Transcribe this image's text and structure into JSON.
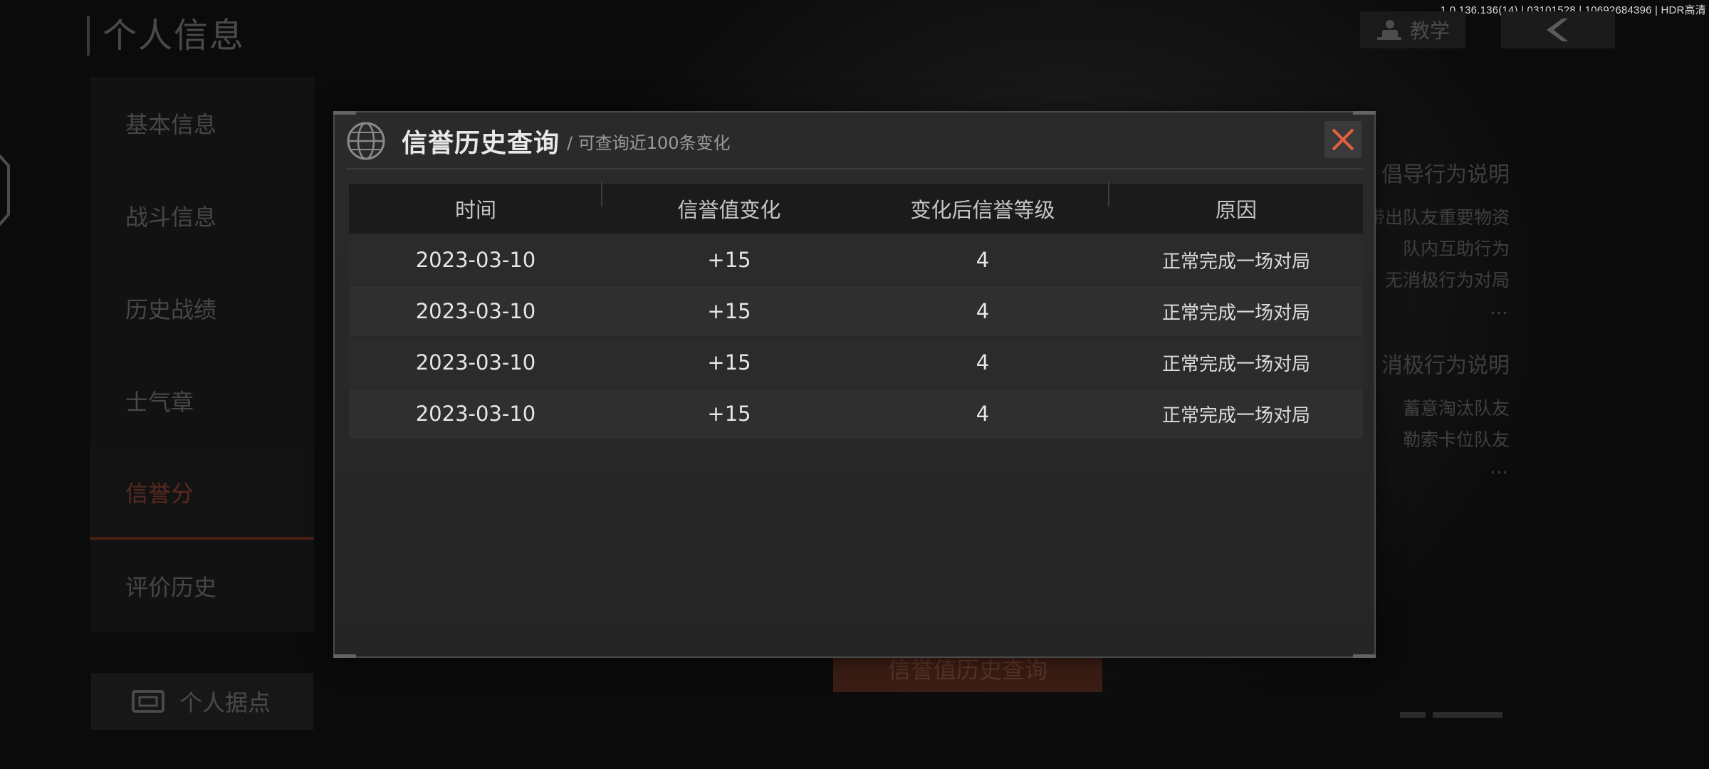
{
  "build_info": "1.0.136.136(14) | 03101528 | 10692684396 | HDR高清",
  "header": {
    "title": "个人信息",
    "tutorial_label": "教学"
  },
  "sidebar": {
    "items": [
      {
        "label": "基本信息"
      },
      {
        "label": "战斗信息"
      },
      {
        "label": "历史战绩"
      },
      {
        "label": "士气章"
      },
      {
        "label": "信誉分"
      },
      {
        "label": "评价历史"
      }
    ],
    "active_index": 4,
    "stronghold_label": "个人据点"
  },
  "right_panel": {
    "positive_title": "倡导行为说明",
    "positive_lines": [
      "带出队友重要物资",
      "队内互助行为",
      "无消极行为对局"
    ],
    "negative_title": "消极行为说明",
    "negative_lines": [
      "蓄意淘汰队友",
      "勒索卡位队友"
    ],
    "ellipsis": "…"
  },
  "bottom_button_label": "信誉值历史查询",
  "modal": {
    "title": "信誉历史查询",
    "subtitle": "/ 可查询近100条变化",
    "columns": [
      "时间",
      "信誉值变化",
      "变化后信誉等级",
      "原因"
    ],
    "rows": [
      {
        "date": "2023-03-10",
        "change": "+15",
        "level": "4",
        "reason": "正常完成一场对局"
      },
      {
        "date": "2023-03-10",
        "change": "+15",
        "level": "4",
        "reason": "正常完成一场对局"
      },
      {
        "date": "2023-03-10",
        "change": "+15",
        "level": "4",
        "reason": "正常完成一场对局"
      },
      {
        "date": "2023-03-10",
        "change": "+15",
        "level": "4",
        "reason": "正常完成一场对局"
      }
    ]
  },
  "colors": {
    "accent_orange": "#e8603c",
    "modal_bg": "#2a2a2b"
  },
  "icons": {
    "close": "close-icon",
    "globe": "globe-icon",
    "back": "back-arrow-icon",
    "tutorial": "tutorial-icon",
    "stronghold": "stronghold-icon"
  }
}
